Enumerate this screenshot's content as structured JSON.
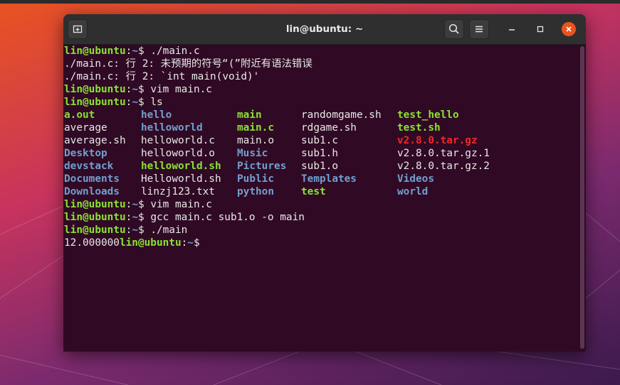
{
  "window": {
    "title": "lin@ubuntu: ~"
  },
  "colors": {
    "prompt_user": "#8ae234",
    "prompt_path": "#729fcf",
    "directory": "#729fcf",
    "executable": "#8ae234",
    "archive": "#ef2929",
    "terminal_bg": "#300a24",
    "close_button": "#e95420"
  },
  "icons": {
    "new_tab": "new-tab-icon",
    "search": "search-icon",
    "menu": "hamburger-menu-icon",
    "minimize": "minimize-icon",
    "maximize": "maximize-icon",
    "close": "close-icon"
  },
  "prompt": {
    "user": "lin@ubuntu",
    "colon": ":",
    "path": "~",
    "symbol": "$ "
  },
  "terminal": {
    "cmd1": "./main.c",
    "err1": "./main.c: 行 2: 未预期的符号“(”附近有语法错误",
    "err2": "./main.c: 行 2: `int main(void)'",
    "cmd2": "vim main.c",
    "cmd3": "ls",
    "ls_rows": [
      [
        {
          "name": "a.out",
          "type": "exec"
        },
        {
          "name": "hello",
          "type": "dir"
        },
        {
          "name": "main",
          "type": "exec"
        },
        {
          "name": "randomgame.sh",
          "type": "file"
        },
        {
          "name": "test_hello",
          "type": "exec"
        }
      ],
      [
        {
          "name": "average",
          "type": "file"
        },
        {
          "name": "helloworld",
          "type": "dir"
        },
        {
          "name": "main.c",
          "type": "exec"
        },
        {
          "name": "rdgame.sh",
          "type": "file"
        },
        {
          "name": "test.sh",
          "type": "exec"
        }
      ],
      [
        {
          "name": "average.sh",
          "type": "file"
        },
        {
          "name": "helloworld.c",
          "type": "file"
        },
        {
          "name": "main.o",
          "type": "file"
        },
        {
          "name": "sub1.c",
          "type": "file"
        },
        {
          "name": "v2.8.0.tar.gz",
          "type": "archive"
        }
      ],
      [
        {
          "name": "Desktop",
          "type": "dir"
        },
        {
          "name": "helloworld.o",
          "type": "file"
        },
        {
          "name": "Music",
          "type": "dir"
        },
        {
          "name": "sub1.h",
          "type": "file"
        },
        {
          "name": "v2.8.0.tar.gz.1",
          "type": "file"
        }
      ],
      [
        {
          "name": "devstack",
          "type": "dir"
        },
        {
          "name": "helloworld.sh",
          "type": "exec"
        },
        {
          "name": "Pictures",
          "type": "dir"
        },
        {
          "name": "sub1.o",
          "type": "file"
        },
        {
          "name": "v2.8.0.tar.gz.2",
          "type": "file"
        }
      ],
      [
        {
          "name": "Documents",
          "type": "dir"
        },
        {
          "name": "Helloworld.sh",
          "type": "file"
        },
        {
          "name": "Public",
          "type": "dir"
        },
        {
          "name": "Templates",
          "type": "dir"
        },
        {
          "name": "Videos",
          "type": "dir"
        }
      ],
      [
        {
          "name": "Downloads",
          "type": "dir"
        },
        {
          "name": "linzj123.txt",
          "type": "file"
        },
        {
          "name": "python",
          "type": "dir"
        },
        {
          "name": "test",
          "type": "exec"
        },
        {
          "name": "world",
          "type": "dir"
        }
      ]
    ],
    "cmd4": "vim main.c",
    "cmd5": "gcc main.c sub1.o -o main",
    "cmd6": "./main",
    "output1": "12.000000"
  }
}
